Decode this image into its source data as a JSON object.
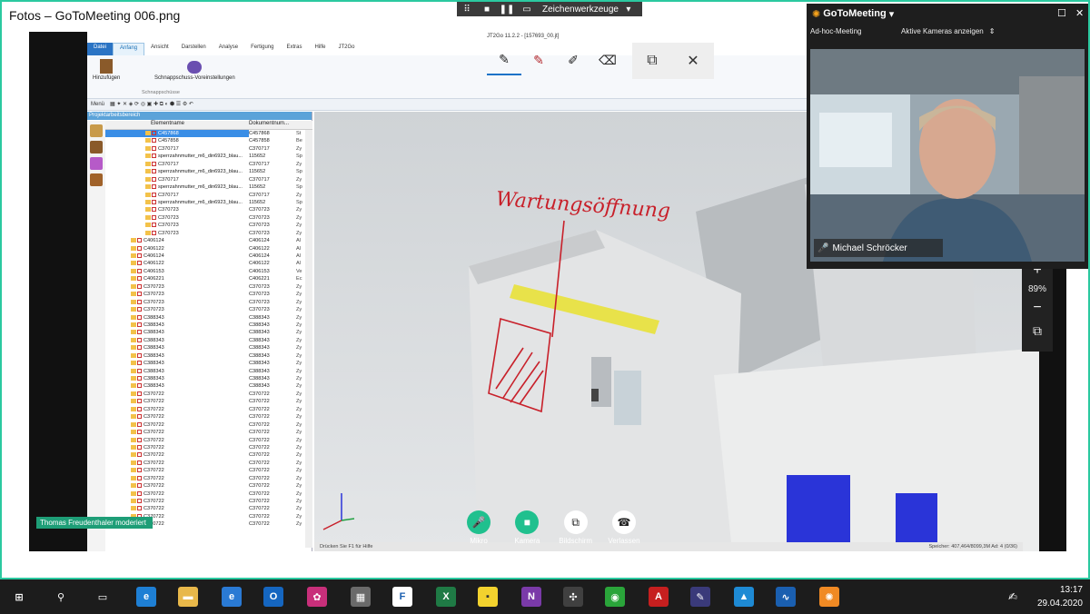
{
  "window": {
    "title": "Fotos – GoToMeeting 006.png",
    "min": "—",
    "max": "☐",
    "close": "✕"
  },
  "presenter_toolbar": {
    "grid": "⠿",
    "stop": "■",
    "pause": "❚❚",
    "screen": "▭",
    "drawing_tools": "Zeichenwerkzeuge",
    "caret": "▾"
  },
  "app": {
    "title": "JT2Go 11.2.2 - [157693_00.jt]",
    "tabs": [
      "Datei",
      "Anfang",
      "Ansicht",
      "Darstellen",
      "Analyse",
      "Fertigung",
      "Extras",
      "Hilfe",
      "JT2Go"
    ],
    "ribbon": {
      "add_label": "Hinzufügen",
      "snapshot_settings": "Schnappschuss-Voreinstellungen",
      "group_label": "Schnappschüsse"
    },
    "quick_access": "Menü",
    "panel_title": "Projektarbeitsbereich",
    "tree_columns": [
      "Elementname",
      "Dokumentnum..."
    ],
    "tree_rows": [
      {
        "name": "C457868",
        "doc": "C457868",
        "x": "St",
        "sel": true
      },
      {
        "name": "C457858",
        "doc": "C457858",
        "x": "Be"
      },
      {
        "name": "C370717",
        "doc": "C370717",
        "x": "Zy"
      },
      {
        "name": "sperrzahnmutter_m6_din6923_blau...",
        "doc": "115652",
        "x": "Sp"
      },
      {
        "name": "C370717",
        "doc": "C370717",
        "x": "Zy"
      },
      {
        "name": "sperrzahnmutter_m6_din6923_blau...",
        "doc": "115652",
        "x": "Sp"
      },
      {
        "name": "C370717",
        "doc": "C370717",
        "x": "Zy"
      },
      {
        "name": "sperrzahnmutter_m6_din6923_blau...",
        "doc": "115652",
        "x": "Sp"
      },
      {
        "name": "C370717",
        "doc": "C370717",
        "x": "Zy"
      },
      {
        "name": "sperrzahnmutter_m6_din6923_blau...",
        "doc": "115652",
        "x": "Sp"
      },
      {
        "name": "C370723",
        "doc": "C370723",
        "x": "Zy"
      },
      {
        "name": "C370723",
        "doc": "C370723",
        "x": "Zy"
      },
      {
        "name": "C370723",
        "doc": "C370723",
        "x": "Zy"
      },
      {
        "name": "C370723",
        "doc": "C370723",
        "x": "Zy"
      },
      {
        "name": "C406124",
        "doc": "C406124",
        "x": "Al"
      },
      {
        "name": "C406122",
        "doc": "C406122",
        "x": "Al"
      },
      {
        "name": "C406124",
        "doc": "C406124",
        "x": "Al"
      },
      {
        "name": "C406122",
        "doc": "C406122",
        "x": "Al"
      },
      {
        "name": "C406153",
        "doc": "C406153",
        "x": "Ve"
      },
      {
        "name": "C406221",
        "doc": "C406221",
        "x": "Ec"
      },
      {
        "name": "C370723",
        "doc": "C370723",
        "x": "Zy"
      },
      {
        "name": "C370723",
        "doc": "C370723",
        "x": "Zy"
      },
      {
        "name": "C370723",
        "doc": "C370723",
        "x": "Zy"
      },
      {
        "name": "C370723",
        "doc": "C370723",
        "x": "Zy"
      },
      {
        "name": "C388343",
        "doc": "C388343",
        "x": "Zy"
      },
      {
        "name": "C388343",
        "doc": "C388343",
        "x": "Zy"
      },
      {
        "name": "C388343",
        "doc": "C388343",
        "x": "Zy"
      },
      {
        "name": "C388343",
        "doc": "C388343",
        "x": "Zy"
      },
      {
        "name": "C388343",
        "doc": "C388343",
        "x": "Zy"
      },
      {
        "name": "C388343",
        "doc": "C388343",
        "x": "Zy"
      },
      {
        "name": "C388343",
        "doc": "C388343",
        "x": "Zy"
      },
      {
        "name": "C388343",
        "doc": "C388343",
        "x": "Zy"
      },
      {
        "name": "C388343",
        "doc": "C388343",
        "x": "Zy"
      },
      {
        "name": "C388343",
        "doc": "C388343",
        "x": "Zy"
      },
      {
        "name": "C370722",
        "doc": "C370722",
        "x": "Zy"
      },
      {
        "name": "C370722",
        "doc": "C370722",
        "x": "Zy"
      },
      {
        "name": "C370722",
        "doc": "C370722",
        "x": "Zy"
      },
      {
        "name": "C370722",
        "doc": "C370722",
        "x": "Zy"
      },
      {
        "name": "C370722",
        "doc": "C370722",
        "x": "Zy"
      },
      {
        "name": "C370722",
        "doc": "C370722",
        "x": "Zy"
      },
      {
        "name": "C370722",
        "doc": "C370722",
        "x": "Zy"
      },
      {
        "name": "C370722",
        "doc": "C370722",
        "x": "Zy"
      },
      {
        "name": "C370722",
        "doc": "C370722",
        "x": "Zy"
      },
      {
        "name": "C370722",
        "doc": "C370722",
        "x": "Zy"
      },
      {
        "name": "C370722",
        "doc": "C370722",
        "x": "Zy"
      },
      {
        "name": "C370722",
        "doc": "C370722",
        "x": "Zy"
      },
      {
        "name": "C370722",
        "doc": "C370722",
        "x": "Zy"
      },
      {
        "name": "C370722",
        "doc": "C370722",
        "x": "Zy"
      },
      {
        "name": "C370722",
        "doc": "C370722",
        "x": "Zy"
      },
      {
        "name": "C370722",
        "doc": "C370722",
        "x": "Zy"
      },
      {
        "name": "C370722",
        "doc": "C370722",
        "x": "Zy"
      },
      {
        "name": "C370722",
        "doc": "C370722",
        "x": "Zy"
      }
    ],
    "annotation": "Wartungsöffnung",
    "status_left": "Drücken Sie F1 für Hilfe",
    "status_right": "Speicher: 407,464/8099,3M  Ad: 4 (0/36)"
  },
  "moderator": "Thomas Freudenthaler moderiert",
  "call_controls": [
    {
      "label": "Mikro",
      "icon": "microphone-icon",
      "glyph": "🎤"
    },
    {
      "label": "Kamera",
      "icon": "camera-icon",
      "glyph": "■"
    },
    {
      "label": "Bildschirm",
      "icon": "screen-share-icon",
      "glyph": "⧉"
    },
    {
      "label": "Verlassen",
      "icon": "hangup-icon",
      "glyph": "☎"
    }
  ],
  "zoom": {
    "plus": "+",
    "level": "89%",
    "minus": "−",
    "copy": "⧉"
  },
  "gotomeeting": {
    "brand": "GoToMeeting",
    "caret": "▾",
    "meeting": "Ad-hoc-Meeting",
    "show_cameras": "Aktive Kameras anzeigen",
    "participant": "Michael Schröcker",
    "restore": "☐",
    "close": "✕"
  },
  "taskbar": {
    "time": "13:17",
    "date": "29.04.2020"
  },
  "colors": {
    "accent": "#2bc9a0",
    "annotation": "#c8202a",
    "selection": "#3a8ee6"
  }
}
